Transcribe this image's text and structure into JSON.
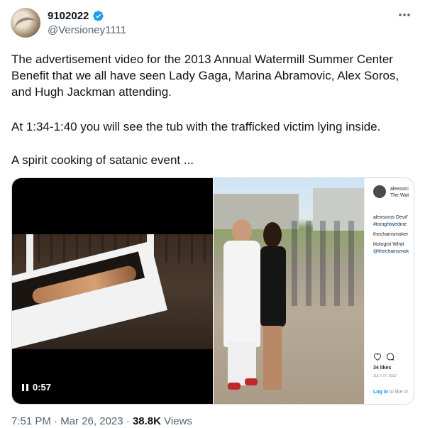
{
  "author": {
    "display_name": "9102022",
    "handle": "@Versioney1111",
    "verified_icon": "verified-badge-icon",
    "verified_color": "#1d9bf0"
  },
  "tweet": {
    "paragraph_1": "The advertisement video for the 2013 Annual Watermill Summer Center Benefit that we all have seen Lady Gaga, Marina Abramovic, Alex Soros, and Hugh Jackman attending.",
    "paragraph_2": "At 1:34-1:40 you will see the tub with the trafficked victim lying inside.",
    "paragraph_3": "A spirit cooking of satanic event ..."
  },
  "video": {
    "duration": "0:57",
    "state_icon": "pause-icon"
  },
  "instagram_panel": {
    "username": "alexsorc",
    "subtitle": "The Wat",
    "lines": [
      "alexsoros Devil'",
      "#tonightwedine",
      "thechainsmoker",
      "litologist What",
      "@thechainsmok"
    ],
    "likes": "34 likes",
    "date": "JULY 27, 2013",
    "login_text": "Log in",
    "login_suffix": " to like or"
  },
  "footer": {
    "time": "7:51 PM",
    "separator": " · ",
    "date": "Mar 26, 2023",
    "views_count": "38.8K",
    "views_label": " Views"
  },
  "colors": {
    "text_primary": "#0f1419",
    "text_secondary": "#536471",
    "border": "#cfd9de"
  }
}
